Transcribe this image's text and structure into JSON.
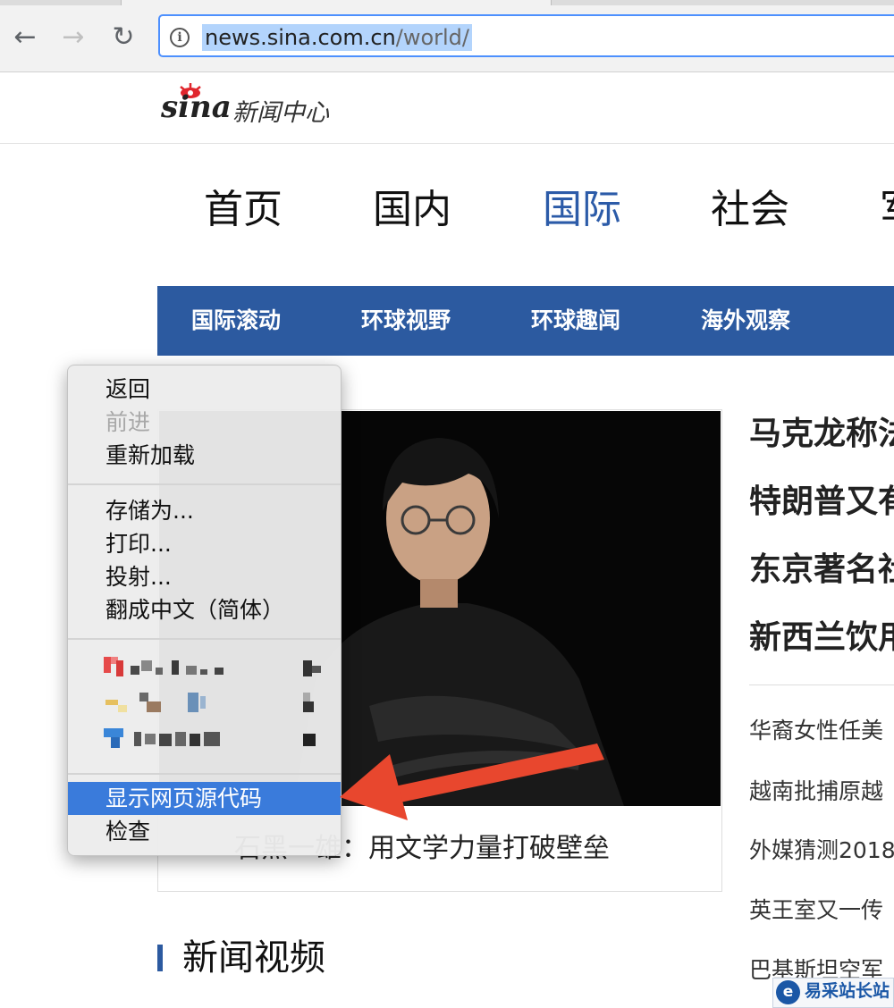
{
  "browser": {
    "url_host": "news.sina.com.cn",
    "url_path": "/world/",
    "info_icon": "i",
    "back_glyph": "←",
    "forward_glyph": "→",
    "reload_glyph": "↻"
  },
  "header": {
    "logo_latin": "sina",
    "logo_cn": "新闻中心"
  },
  "main_nav": [
    "首页",
    "国内",
    "国际",
    "社会",
    "军"
  ],
  "main_nav_active": "国际",
  "sub_nav": [
    "国际滚动",
    "环球视野",
    "环球趣闻",
    "海外观察"
  ],
  "feature": {
    "caption": "石黑一雄：用文学力量打破壁垒"
  },
  "headlines": [
    "马克龙称法",
    "特朗普又有",
    "东京著名社",
    "新西兰饮用"
  ],
  "news_list": [
    "华裔女性任美",
    "越南批捕原越",
    "外媒猜测2018",
    "英王室又一传",
    "巴基斯坦空军"
  ],
  "section_title": "新闻视频",
  "context_menu": {
    "group1": [
      "返回",
      "前进",
      "重新加载"
    ],
    "group2": [
      "存储为...",
      "打印...",
      "投射...",
      "翻成中文（简体）"
    ],
    "group4": [
      "显示网页源代码",
      "检查"
    ],
    "disabled_item": "前进",
    "highlighted_item": "显示网页源代码"
  },
  "watermark": {
    "icon": "e",
    "text": "易采站长站"
  },
  "colors": {
    "accent_blue": "#2c5aa0",
    "highlight": "#3a7bdb",
    "arrow_red": "#e8472e"
  }
}
